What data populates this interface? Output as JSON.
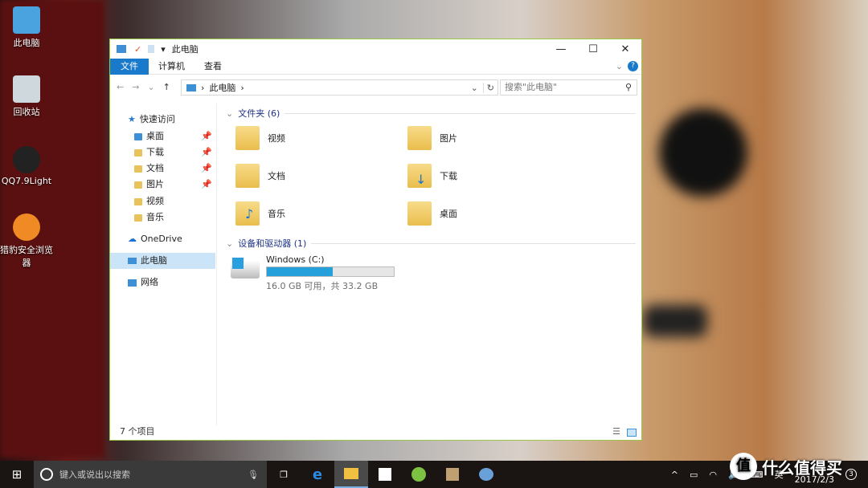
{
  "desktop": {
    "icons": [
      {
        "label": "此电脑"
      },
      {
        "label": "回收站"
      },
      {
        "label": "QQ7.9Light"
      },
      {
        "label": "猎豹安全浏览器"
      }
    ]
  },
  "window": {
    "title": "此电脑",
    "ribbon_tabs": [
      "文件",
      "计算机",
      "查看"
    ],
    "address": "此电脑",
    "search_placeholder": "搜索\"此电脑\"",
    "sidebar": {
      "quick_access": "快速访问",
      "items": [
        "桌面",
        "下载",
        "文档",
        "图片",
        "视频",
        "音乐"
      ],
      "onedrive": "OneDrive",
      "this_pc": "此电脑",
      "network": "网络"
    },
    "folders_header": "文件夹 (6)",
    "folders": [
      "视频",
      "图片",
      "文档",
      "下载",
      "音乐",
      "桌面"
    ],
    "drives_header": "设备和驱动器 (1)",
    "drive": {
      "name": "Windows (C:)",
      "info": "16.0 GB 可用，共 33.2 GB",
      "used_percent": 52
    },
    "status": "7 个项目"
  },
  "taskbar": {
    "search_placeholder": "键入或说出以搜索",
    "ime": "英",
    "date": "2017/2/3",
    "notifications": "3"
  },
  "watermark": "什么值得买",
  "colors": {
    "accent": "#1979ca",
    "drive_bar": "#26a0da"
  }
}
